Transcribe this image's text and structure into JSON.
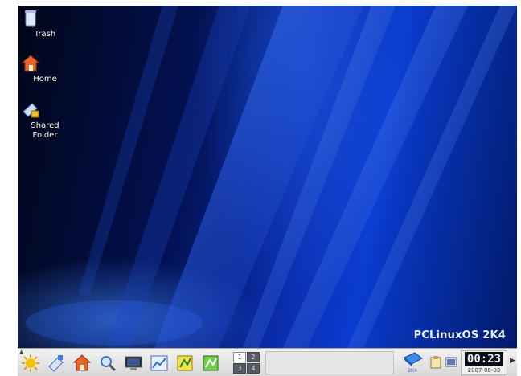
{
  "desktop": {
    "icons": [
      {
        "label": "Trash",
        "icon": "trash-icon"
      },
      {
        "label": "Home",
        "icon": "home-icon"
      },
      {
        "label": "Shared Folder",
        "icon": "shared-folder-icon"
      }
    ],
    "brand": "PCLinuxOS 2K4"
  },
  "taskbar": {
    "launchers": [
      {
        "icon": "kde-menu-icon"
      },
      {
        "icon": "terminal-wizard-icon"
      },
      {
        "icon": "home-folder-icon"
      },
      {
        "icon": "search-icon"
      },
      {
        "icon": "monitor-icon"
      },
      {
        "icon": "chart-tool-icon"
      },
      {
        "icon": "notepad-icon"
      },
      {
        "icon": "spreadsheet-icon"
      }
    ],
    "pager": [
      "1",
      "2",
      "3",
      "4"
    ],
    "tray": {
      "os_label": "2K4"
    },
    "clock": {
      "time": "00:23",
      "date": "2007-08-03"
    }
  },
  "colors": {
    "wallpaper_base": "#031255",
    "wallpaper_accent": "#0b3bd0",
    "taskbar": "#e4e4e4"
  }
}
